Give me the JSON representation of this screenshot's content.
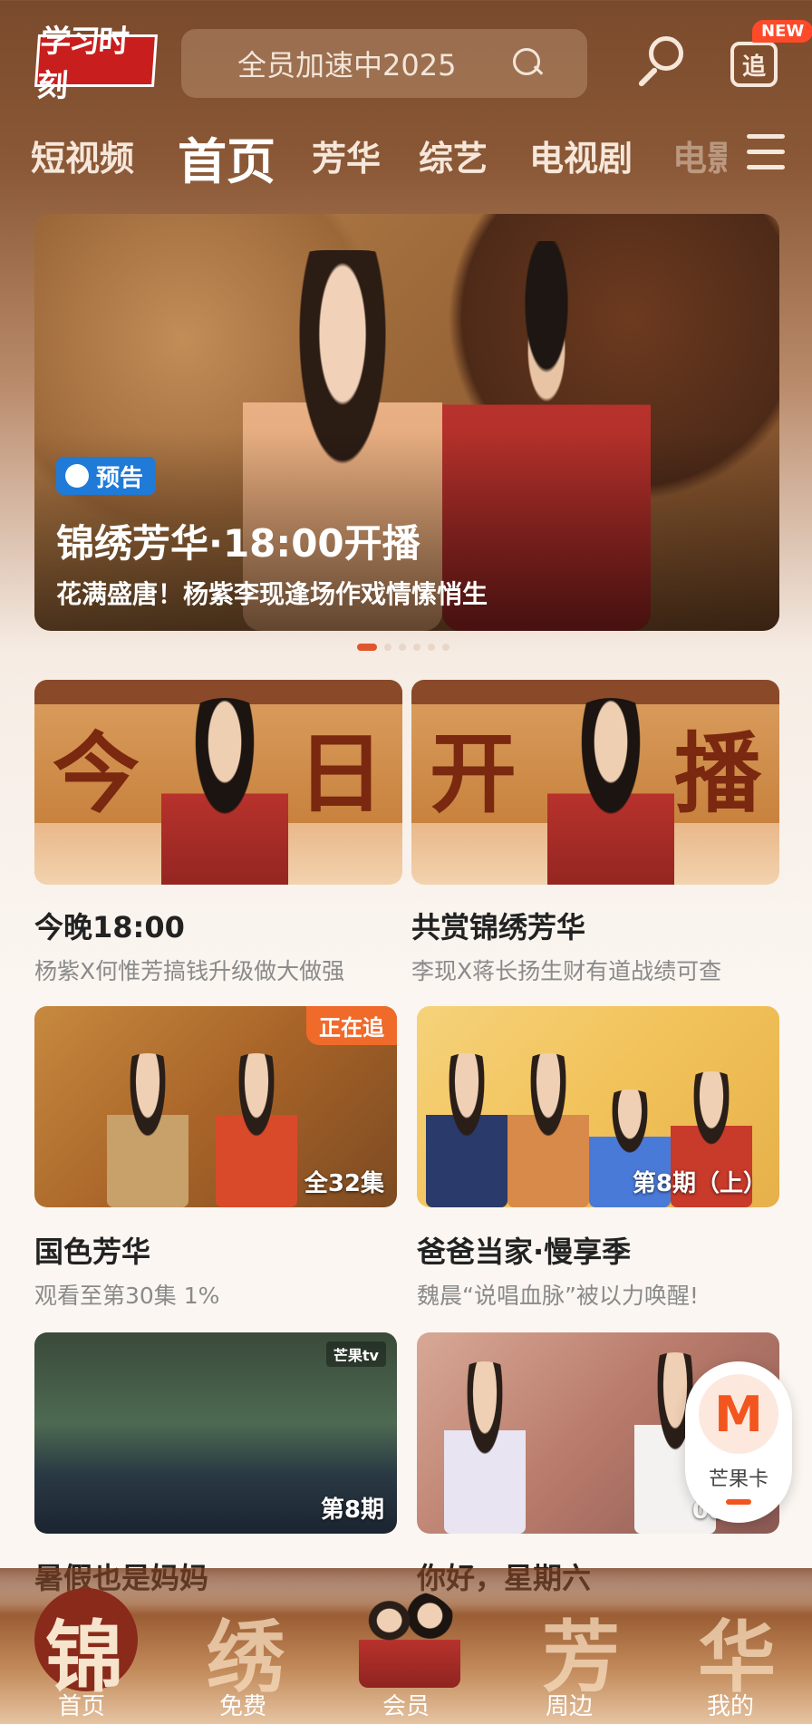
{
  "header": {
    "logo_text": "学习时刻",
    "search_placeholder": "全员加速中2025",
    "zhui_label": "追",
    "new_badge": "NEW"
  },
  "nav": {
    "tabs": [
      {
        "label": "短视频",
        "active": false
      },
      {
        "label": "首页",
        "active": true
      },
      {
        "label": "芳华",
        "active": false
      },
      {
        "label": "综艺",
        "active": false
      },
      {
        "label": "电视剧",
        "active": false
      },
      {
        "label": "电影",
        "active": false
      }
    ]
  },
  "banner": {
    "badge": "预告",
    "title": "锦绣芳华·18:00开播",
    "subtitle": "花满盛唐！杨紫李现逢场作戏情愫悄生",
    "dot_count": 6,
    "active_dot": 0
  },
  "feature_cards": [
    {
      "chars": [
        "今",
        "日"
      ],
      "title": "今晚18:00",
      "subtitle": "杨紫X何惟芳搞钱升级做大做强"
    },
    {
      "chars": [
        "开",
        "播"
      ],
      "title": "共赏锦绣芳华",
      "subtitle": "李现X蒋长扬生财有道战绩可查"
    }
  ],
  "poster_cards": [
    {
      "title": "国色芳华",
      "subtitle": "观看至第30集 1%",
      "top_badge": "正在追",
      "corner_label": "全32集"
    },
    {
      "title": "爸爸当家·慢享季",
      "subtitle": "魏晨“说唱血脉”被以力唤醒!",
      "top_badge": "",
      "corner_label": "第8期（上）"
    },
    {
      "title": "暑假也是妈妈",
      "subtitle": "",
      "top_badge": "",
      "corner_label": "第8期",
      "logo": "芒果tv"
    },
    {
      "title": "你好，星期六",
      "subtitle": "",
      "top_badge": "",
      "corner_label": "08"
    }
  ],
  "mango_float": {
    "icon_letter": "M",
    "label": "芒果卡"
  },
  "bottom_nav": {
    "items": [
      {
        "char": "锦",
        "label": "首页",
        "active": true
      },
      {
        "char": "绣",
        "label": "免费",
        "active": false
      },
      {
        "char": "",
        "label": "会员",
        "active": false
      },
      {
        "char": "芳",
        "label": "周边",
        "active": false
      },
      {
        "char": "华",
        "label": "我的",
        "active": false
      }
    ]
  },
  "colors": {
    "accent": "#f06a2a",
    "preview_badge": "#1f7ad8",
    "logo_red": "#c81e1e"
  }
}
